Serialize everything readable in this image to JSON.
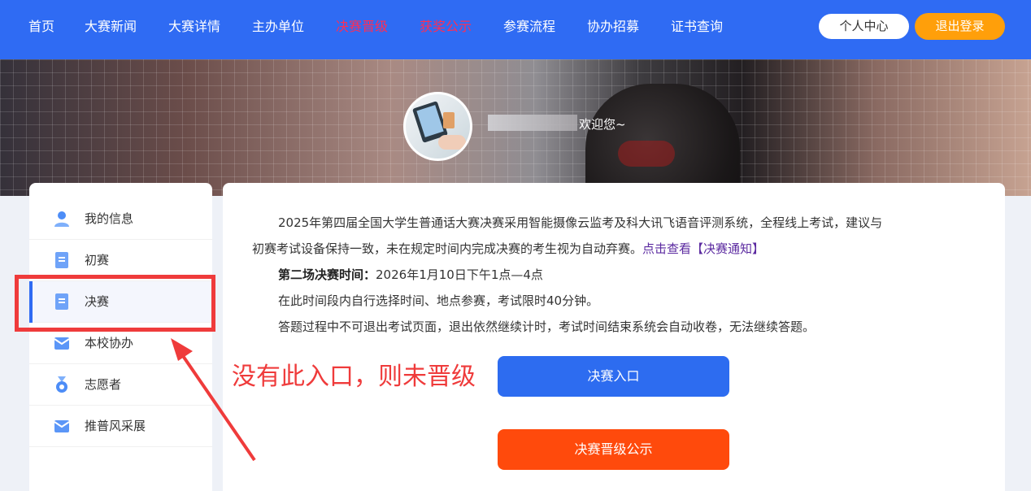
{
  "nav": {
    "items": [
      {
        "label": "首页"
      },
      {
        "label": "大赛新闻"
      },
      {
        "label": "大赛详情"
      },
      {
        "label": "主办单位"
      },
      {
        "label": "决赛晋级"
      },
      {
        "label": "获奖公示"
      },
      {
        "label": "参赛流程"
      },
      {
        "label": "协办招募"
      },
      {
        "label": "证书查询"
      }
    ],
    "profile_label": "个人中心",
    "logout_label": "退出登录",
    "highlight_color": "#ff2d55"
  },
  "banner": {
    "welcome": "欢迎您~"
  },
  "sidebar": {
    "items": [
      {
        "label": "我的信息",
        "icon": "user-icon"
      },
      {
        "label": "初赛",
        "icon": "document-icon"
      },
      {
        "label": "决赛",
        "icon": "document-icon",
        "active": true
      },
      {
        "label": "本校协办",
        "icon": "mail-icon"
      },
      {
        "label": "志愿者",
        "icon": "medal-icon"
      },
      {
        "label": "推普风采展",
        "icon": "mail-icon"
      }
    ]
  },
  "annotation": {
    "text": "没有此入口，则未晋级",
    "color": "#ef3b3b"
  },
  "main": {
    "intro_line1": "2025年第四届全国大学生普通话大赛决赛采用智能摄像云监考及科大讯飞语音评测系统，全程线上考试，建议与",
    "intro_line2": "初赛考试设备保持一致，未在规定时间内完成决赛的考生视为自动弃赛。",
    "notice_link": "点击查看【决赛通知】",
    "time_label": "第二场决赛时间：",
    "time_value": "2026年1月10日下午1点—4点",
    "rule1": "在此时间段内自行选择时间、地点参赛，考试限时40分钟。",
    "rule2": "答题过程中不可退出考试页面，退出依然继续计时，考试时间结束系统会自动收卷，无法继续答题。",
    "entry_button": "决赛入口",
    "promotion_button": "决赛晋级公示"
  }
}
